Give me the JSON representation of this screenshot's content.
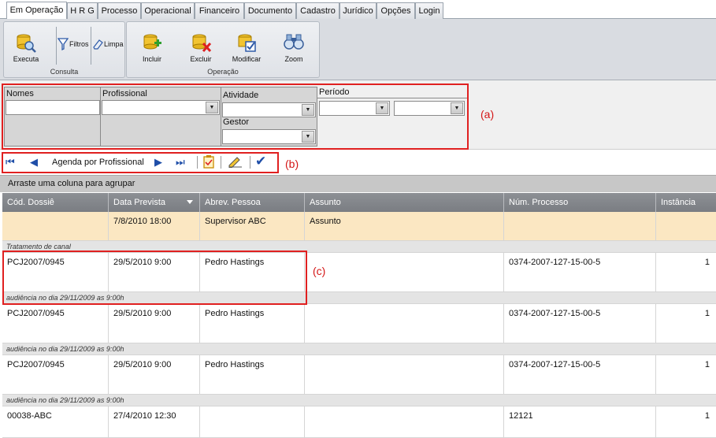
{
  "tabs": [
    {
      "label": "Em Operação",
      "active": true
    },
    {
      "label": "H R G"
    },
    {
      "label": "Processo"
    },
    {
      "label": "Operacional"
    },
    {
      "label": "Financeiro"
    },
    {
      "label": "Documento"
    },
    {
      "label": "Cadastro"
    },
    {
      "label": "Jurídico"
    },
    {
      "label": "Opções"
    },
    {
      "label": "Login"
    }
  ],
  "ribbon": {
    "consulta": {
      "label": "Consulta",
      "executa": "Executa",
      "filtros": "Filtros",
      "limpa": "Limpa"
    },
    "operacao": {
      "label": "Operação",
      "incluir": "Incluir",
      "excluir": "Excluir",
      "modificar": "Modificar",
      "zoom": "Zoom"
    }
  },
  "filters": {
    "nomes_label": "Nomes",
    "profissional_label": "Profissional",
    "atividade_label": "Atividade",
    "gestor_label": "Gestor",
    "periodo_label": "Período"
  },
  "annotations": {
    "a": "(a)",
    "b": "(b)",
    "c": "(c)"
  },
  "navbar": {
    "title": "Agenda por Profissional"
  },
  "grid": {
    "group_hint": "Arraste uma coluna para agrupar",
    "columns": [
      "Cód. Dossiê",
      "Data Prevista",
      "Abrev. Pessoa",
      "Assunto",
      "Núm. Processo",
      "Instância"
    ],
    "new_row": {
      "data": "7/8/2010 18:00",
      "pessoa": "Supervisor ABC",
      "assunto": "Assunto"
    },
    "tratamento": "Tratamento de canal",
    "rows": [
      {
        "dossie": "PCJ2007/0945",
        "data": "29/5/2010 9:00",
        "pessoa": "Pedro Hastings",
        "assunto": "",
        "processo": "0374-2007-127-15-00-5",
        "instancia": "1",
        "note": "audiência no dia 29/11/2009 as 9:00h"
      },
      {
        "dossie": "PCJ2007/0945",
        "data": "29/5/2010 9:00",
        "pessoa": "Pedro Hastings",
        "assunto": "",
        "processo": "0374-2007-127-15-00-5",
        "instancia": "1",
        "note": "audiência no dia 29/11/2009 as 9:00h"
      },
      {
        "dossie": "PCJ2007/0945",
        "data": "29/5/2010 9:00",
        "pessoa": "Pedro Hastings",
        "assunto": "",
        "processo": "0374-2007-127-15-00-5",
        "instancia": "1",
        "note": "audiência no dia 29/11/2009 as 9:00h"
      },
      {
        "dossie": "00038-ABC",
        "data": "27/4/2010 12:30",
        "pessoa": "",
        "assunto": "",
        "processo": "12121",
        "instancia": "1",
        "note": ""
      }
    ]
  }
}
